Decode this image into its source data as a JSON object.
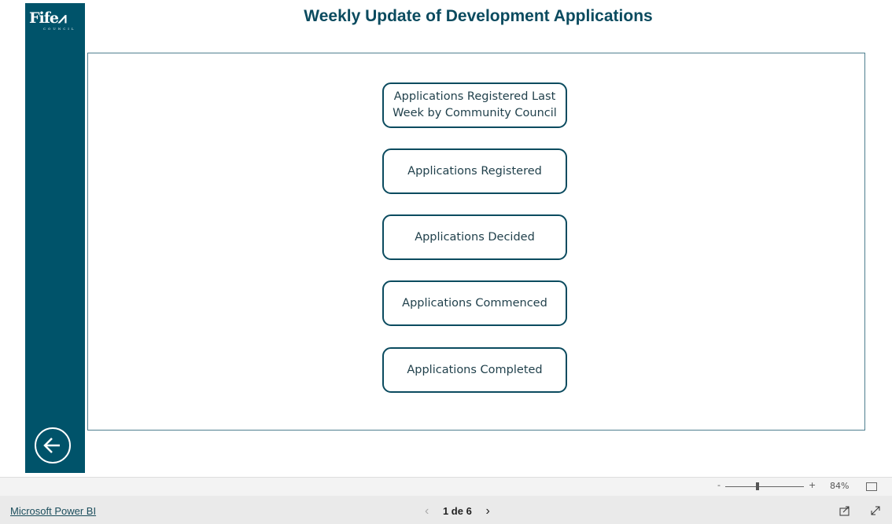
{
  "logo": {
    "text": "Fife",
    "sub": "COUNCIL"
  },
  "header": {
    "title": "Weekly Update of Development Applications"
  },
  "buttons": [
    {
      "label": "Applications Registered Last Week by Community Council"
    },
    {
      "label": "Applications Registered"
    },
    {
      "label": "Applications Decided"
    },
    {
      "label": "Applications Commenced"
    },
    {
      "label": "Applications Completed"
    }
  ],
  "zoom": {
    "minus": "-",
    "plus": "+",
    "value": "84%",
    "level_percent": 84
  },
  "footer": {
    "brand": "Microsoft Power BI",
    "page": "1 de 6",
    "prev": "‹",
    "next": "›"
  },
  "colors": {
    "brand": "#00536a"
  }
}
